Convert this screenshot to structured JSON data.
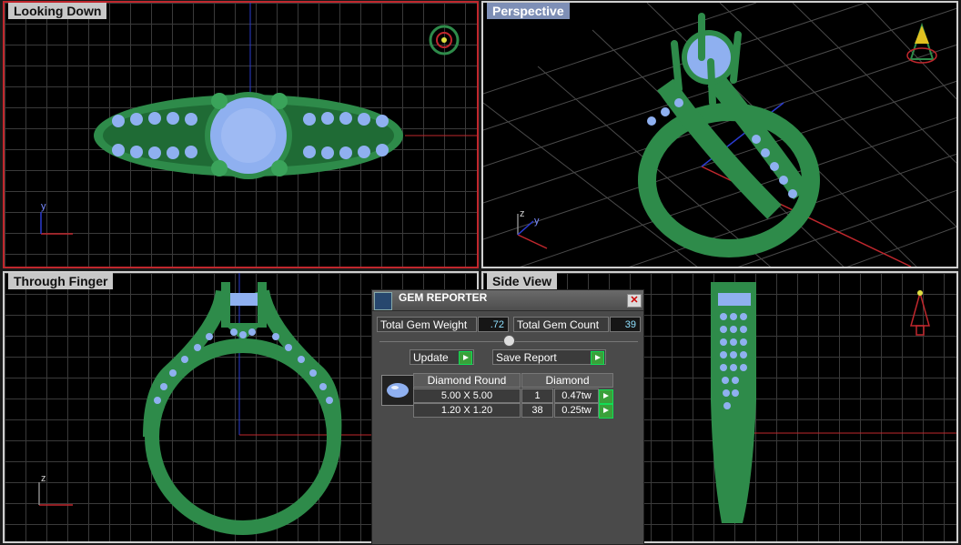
{
  "viewports": {
    "top_left": {
      "label": "Looking Down",
      "axis_label": "y"
    },
    "top_right": {
      "label": "Perspective",
      "axis_label_1": "z",
      "axis_label_2": "y"
    },
    "bottom_left": {
      "label": "Through Finger",
      "axis_label": "z"
    },
    "bottom_right": {
      "label": "Side View"
    }
  },
  "gem_reporter": {
    "title": "GEM REPORTER",
    "total_gem_weight_label": "Total Gem Weight",
    "total_gem_weight_value": ".72",
    "total_gem_count_label": "Total Gem Count",
    "total_gem_count_value": "39",
    "update_label": "Update",
    "save_report_label": "Save Report",
    "table": {
      "headers": [
        "Diamond Round",
        "Diamond"
      ],
      "rows": [
        {
          "size": "5.00 X 5.00",
          "count": "1",
          "weight": "0.47tw"
        },
        {
          "size": "1.20 X 1.20",
          "count": "38",
          "weight": "0.25tw"
        }
      ]
    }
  },
  "colors": {
    "metal": "#2e8b4a",
    "gem": "#8fb0f0",
    "active_border": "#c0272d",
    "axis_red": "#c0272d",
    "axis_blue": "#2a3bd0"
  },
  "icons": [
    "gem-icon",
    "close-icon",
    "arrow-right-icon",
    "compass-icon",
    "tree-icon"
  ]
}
